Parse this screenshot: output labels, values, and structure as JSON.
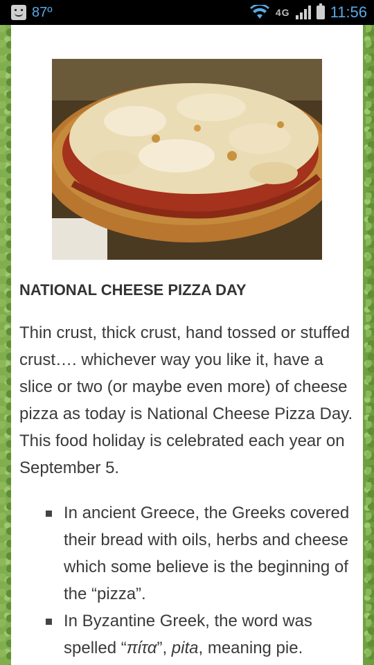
{
  "status_bar": {
    "temperature": "87º",
    "network": "4G",
    "time": "11:56"
  },
  "article": {
    "title": "NATIONAL CHEESE PIZZA DAY",
    "paragraph": "Thin crust, thick crust, hand tossed or stuffed crust…. whichever way you like it, have a slice or two (or maybe even more) of cheese pizza as today is National Cheese Pizza Day.  This food holiday is celebrated each year on September 5.",
    "facts": [
      {
        "text": "In ancient Greece, the Greeks covered their bread with oils, herbs and cheese which some believe is the beginning of the “pizza”."
      },
      {
        "text_before": "In Byzantine Greek, the word was spelled “",
        "greek": "πίτα",
        "text_mid": "”, ",
        "italic": "pita",
        "text_after": ", meaning pie."
      }
    ]
  },
  "colors": {
    "statusbar_bg": "#000000",
    "statusbar_accent": "#5aa9e6",
    "background_green": "#7fae4d",
    "text": "#3a3a3a"
  }
}
